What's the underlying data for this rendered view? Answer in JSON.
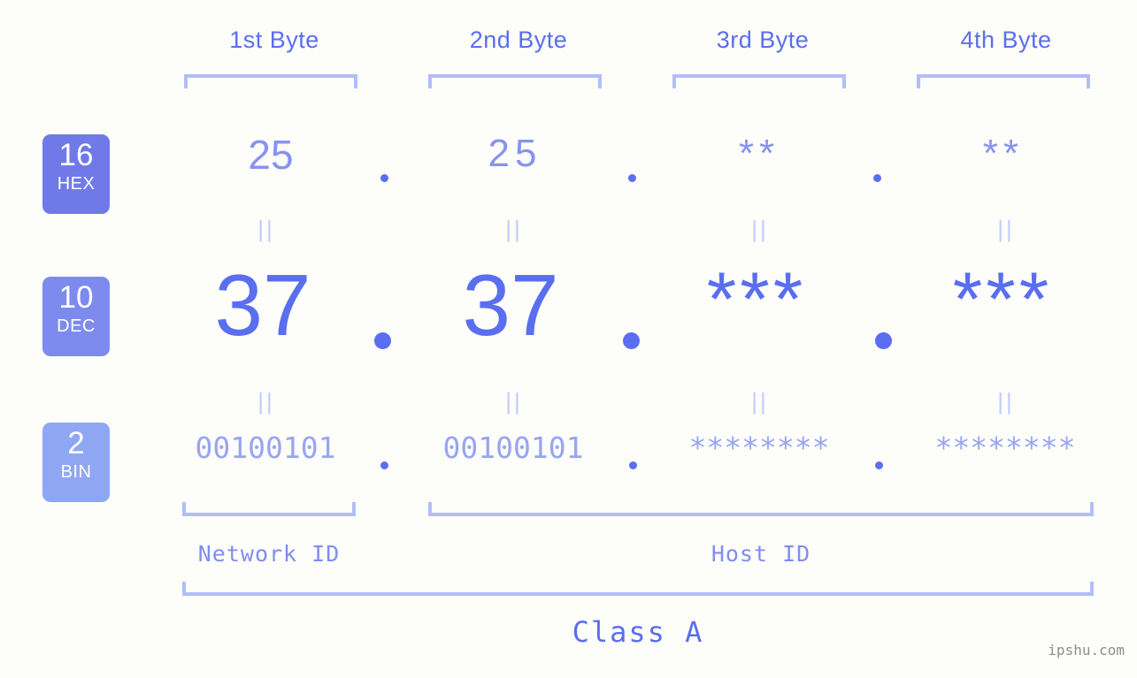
{
  "background_color": "#fdfdfa",
  "accent_colors": {
    "primary": "#5a6ef0",
    "hex_row": "#8893ee",
    "bin_row": "#98a5f2",
    "bracket": "#b4bdfa",
    "equals": "#c3cbfb",
    "badge_hex": "#7079e8",
    "badge_dec": "#7d8bef",
    "badge_bin": "#8fa7f3",
    "watermark": "#8e8e8e"
  },
  "byte_headers": [
    {
      "label": "1st Byte"
    },
    {
      "label": "2nd Byte"
    },
    {
      "label": "3rd Byte"
    },
    {
      "label": "4th Byte"
    }
  ],
  "bases": [
    {
      "number": "16",
      "name": "HEX"
    },
    {
      "number": "10",
      "name": "DEC"
    },
    {
      "number": "2",
      "name": "BIN"
    }
  ],
  "rows": {
    "hex": {
      "base_number": "16",
      "base_name": "HEX",
      "values": [
        "25",
        "25",
        "**",
        "**"
      ]
    },
    "dec": {
      "base_number": "10",
      "base_name": "DEC",
      "values": [
        "37",
        "37",
        "***",
        "***"
      ]
    },
    "bin": {
      "base_number": "2",
      "base_name": "BIN",
      "values": [
        "00100101",
        "00100101",
        "********",
        "********"
      ]
    }
  },
  "separators": {
    "dot": ".",
    "equals": "||"
  },
  "sections": [
    {
      "label": "Network ID"
    },
    {
      "label": "Host ID"
    }
  ],
  "class_label": "Class A",
  "watermark": "ipshu.com"
}
